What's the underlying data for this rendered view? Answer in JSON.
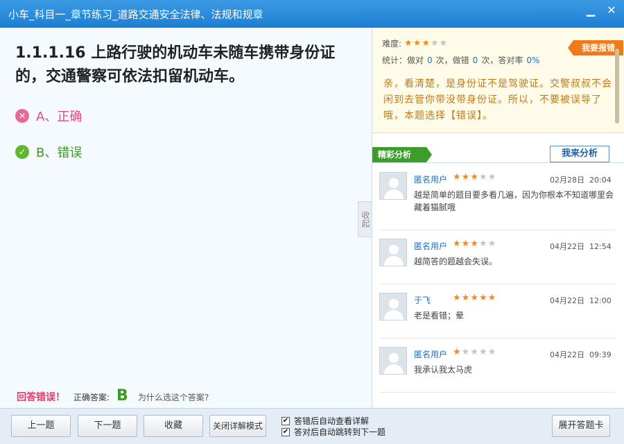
{
  "window": {
    "title": "小车_科目一_章节练习_道路交通安全法律、法规和规章",
    "minimize": "▁",
    "close": "✕"
  },
  "question": {
    "text": "1.1.1.16 上路行驶的机动车未随车携带身份证的，交通警察可依法扣留机动车。",
    "options": [
      {
        "label": "A、正确",
        "status": "wrong"
      },
      {
        "label": "B、错误",
        "status": "correct"
      }
    ]
  },
  "result": {
    "wrong_text": "回答错误！",
    "correct_label": "正确答案:",
    "correct_answer": "B",
    "why": "为什么选这个答案?"
  },
  "collapse_tab": "收起",
  "detail": {
    "difficulty_label": "难度:",
    "difficulty_stars": 3,
    "stats_prefix": "统计：做对",
    "stats_right": "0",
    "stats_mid1": "次，做错",
    "stats_wrong": "0",
    "stats_mid2": "次，答对率",
    "stats_rate": "0%",
    "report": "我要报错",
    "explanation": "亲，看清楚，是身份证不是驾驶证。交警叔叔不会闲到去管你带没带身份证。所以，不要被误导了哦，本题选择【错误】。"
  },
  "analysis": {
    "header": "精彩分析",
    "my_analysis": "我来分析",
    "comments": [
      {
        "user": "匿名用户",
        "stars": 3,
        "date": "02月28日  20:04",
        "text": "越是简单的题目要多看几遍，因为你根本不知道哪里会藏着猫腻哦"
      },
      {
        "user": "匿名用户",
        "stars": 3,
        "date": "04月22日  12:54",
        "text": "越简答的题越会失误。"
      },
      {
        "user": "于飞",
        "stars": 5,
        "date": "04月22日  12:00",
        "text": "老是看错；晕"
      },
      {
        "user": "匿名用户",
        "stars": 1,
        "date": "04月22日  09:39",
        "text": "我承认我太马虎"
      }
    ]
  },
  "toolbar": {
    "prev": "上一题",
    "next": "下一题",
    "favorite": "收藏",
    "close_detail": "关闭详解模式",
    "auto_view": "答错后自动查看详解",
    "auto_jump": "答对后自动跳转到下一题",
    "open_card": "展开答题卡"
  },
  "colors": {
    "titlebar": "#2a8be0",
    "wrong": "#e43a6a",
    "correct": "#3b9b1c",
    "explain_text": "#c07a18",
    "star": "#f08c1e"
  }
}
